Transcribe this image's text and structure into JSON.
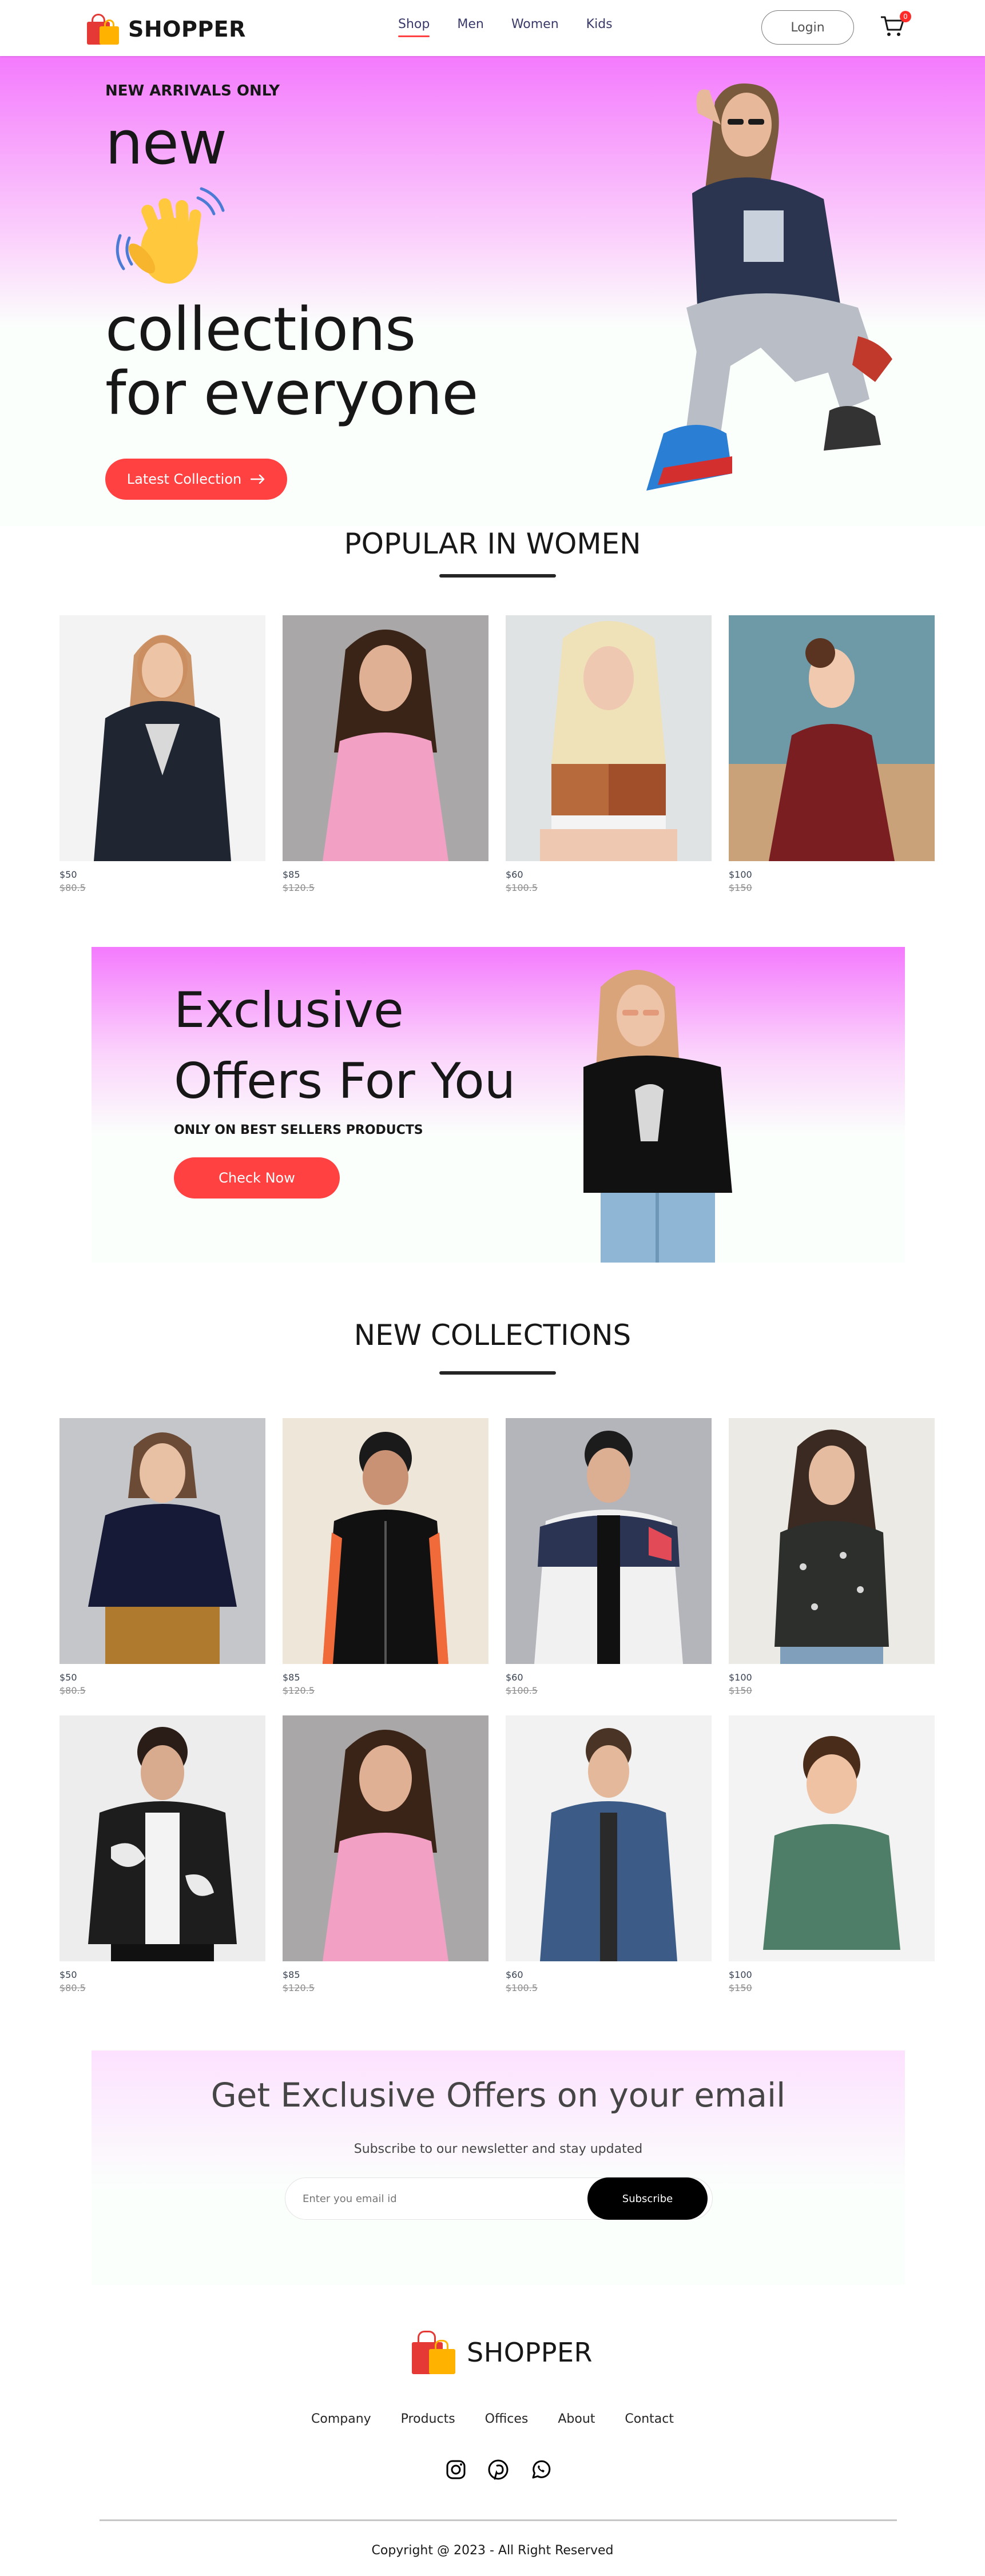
{
  "nav": {
    "brand": "SHOPPER",
    "menu": [
      {
        "label": "Shop",
        "active": true
      },
      {
        "label": "Men",
        "active": false
      },
      {
        "label": "Women",
        "active": false
      },
      {
        "label": "Kids",
        "active": false
      }
    ],
    "login_label": "Login",
    "cart_count": "0",
    "cart_icon": "cart-icon"
  },
  "hero": {
    "eyebrow": "NEW ARRIVALS ONLY",
    "line1": "new",
    "line2": "collections",
    "line3": "for everyone",
    "hand_icon": "waving-hand-icon",
    "button_label": "Latest Collection",
    "button_icon": "arrow-right-icon"
  },
  "popular": {
    "title": "POPULAR IN WOMEN",
    "items": [
      {
        "price": "$50",
        "old_price": "$80.5"
      },
      {
        "price": "$85",
        "old_price": "$120.5"
      },
      {
        "price": "$60",
        "old_price": "$100.5"
      },
      {
        "price": "$100",
        "old_price": "$150"
      }
    ]
  },
  "offers": {
    "line1": "Exclusive",
    "line2": "Offers For You",
    "subtitle": "ONLY ON BEST SELLERS PRODUCTS",
    "button_label": "Check Now"
  },
  "new_collections": {
    "title": "NEW COLLECTIONS",
    "items": [
      {
        "price": "$50",
        "old_price": "$80.5"
      },
      {
        "price": "$85",
        "old_price": "$120.5"
      },
      {
        "price": "$60",
        "old_price": "$100.5"
      },
      {
        "price": "$100",
        "old_price": "$150"
      },
      {
        "price": "$50",
        "old_price": "$80.5"
      },
      {
        "price": "$85",
        "old_price": "$120.5"
      },
      {
        "price": "$60",
        "old_price": "$100.5"
      },
      {
        "price": "$100",
        "old_price": "$150"
      }
    ]
  },
  "newsletter": {
    "title": "Get Exclusive Offers on your email",
    "subtitle": "Subscribe to our newsletter and stay updated",
    "input_placeholder": "Enter you email id",
    "button_label": "Subscribe"
  },
  "footer": {
    "brand": "SHOPPER",
    "links": [
      "Company",
      "Products",
      "Offices",
      "About",
      "Contact"
    ],
    "social_icons": [
      "instagram-icon",
      "pinterest-icon",
      "whatsapp-icon"
    ],
    "copyright": "Copyright @ 2023 - All Right Reserved"
  },
  "colors": {
    "accent": "#ff4141",
    "hero_pink": "#f47afd",
    "text_dark": "#171717",
    "subscribe_bg": "#000000"
  }
}
